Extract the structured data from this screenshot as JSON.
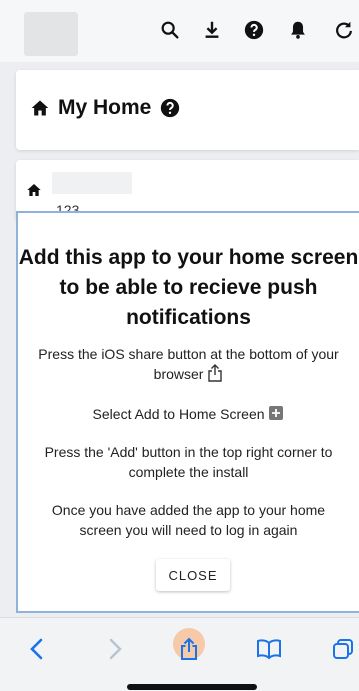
{
  "header": {
    "icons": [
      "search-icon",
      "download-icon",
      "help-icon",
      "bell-icon",
      "refresh-icon"
    ]
  },
  "home_card": {
    "title": "My Home",
    "icon": "home-icon",
    "help_icon": "help-icon"
  },
  "list_card": {
    "icon": "home-icon",
    "number": "123"
  },
  "modal": {
    "heading": "Add this app to your home screen to be able to recieve push notifications",
    "step1": "Press the iOS share button at the bottom of your browser",
    "step2": "Select Add to Home Screen",
    "step3": "Press the 'Add' button in the top right corner to complete the install",
    "step4": "Once you have added the app to your home screen you will need to log in again",
    "close_label": "CLOSE"
  },
  "browser_bar": {
    "icons": [
      "back-icon",
      "forward-icon",
      "share-icon",
      "bookmarks-icon",
      "tabs-icon"
    ]
  },
  "colors": {
    "accent_border": "#8fb2d8",
    "share_highlight": "#f6c9a9",
    "browser_blue": "#1a73e8"
  }
}
